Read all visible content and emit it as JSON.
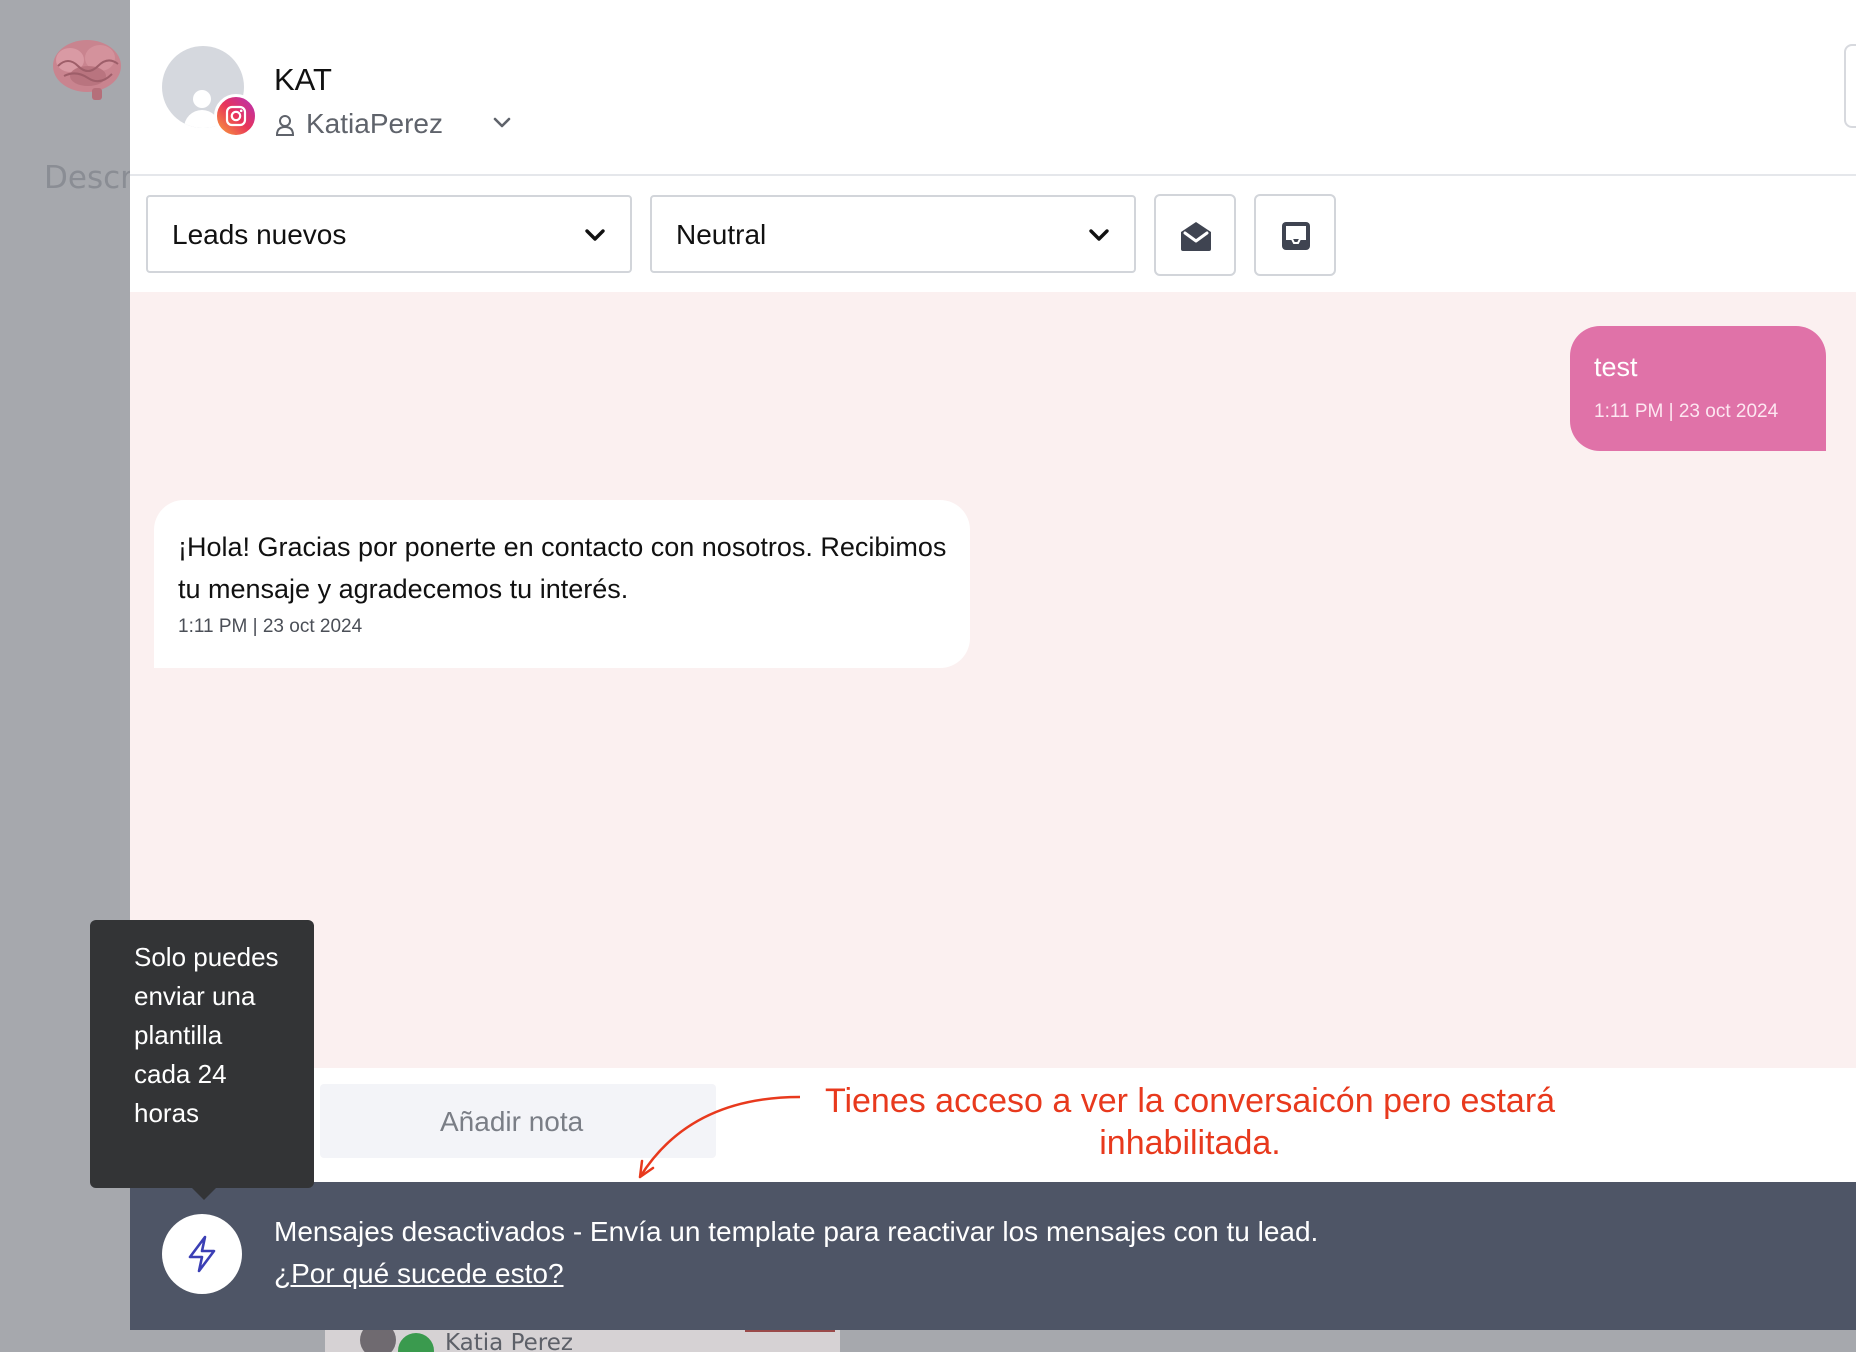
{
  "background": {
    "section_label": "Descr",
    "card_contact_name": "Katia Perez"
  },
  "contact": {
    "name": "KAT",
    "handle": "KatiaPerez",
    "channel_icon": "instagram-icon"
  },
  "toolbar": {
    "pipeline_select": "Leads nuevos",
    "sentiment_select": "Neutral",
    "mark_read_icon": "envelope-open-icon",
    "archive_icon": "inbox-icon"
  },
  "messages": [
    {
      "direction": "outgoing",
      "text": "test",
      "meta": "1:11 PM  |  23 oct 2024"
    },
    {
      "direction": "incoming",
      "text": "¡Hola! Gracias por ponerte en contacto con nosotros. Recibimos tu mensaje y agradecemos tu interés.",
      "meta": "1:11 PM  |  23 oct 2024"
    }
  ],
  "composer": {
    "note_placeholder": "Añadir nota"
  },
  "disabled_bar": {
    "message": "Mensajes desactivados - Envía un template para reactivar los mensajes con tu lead.",
    "link": "¿Por qué sucede esto?"
  },
  "tooltip": {
    "text": "Solo puedes enviar una plantilla cada 24 horas"
  },
  "annotation": {
    "text": "Tienes acceso a ver la conversaicón pero estará inhabilitada."
  },
  "colors": {
    "outgoing_bubble": "#e072a8",
    "chat_background": "#fbf0f0",
    "disabled_bar": "#4e5566",
    "annotation": "#e8391d",
    "tooltip": "#333436"
  }
}
